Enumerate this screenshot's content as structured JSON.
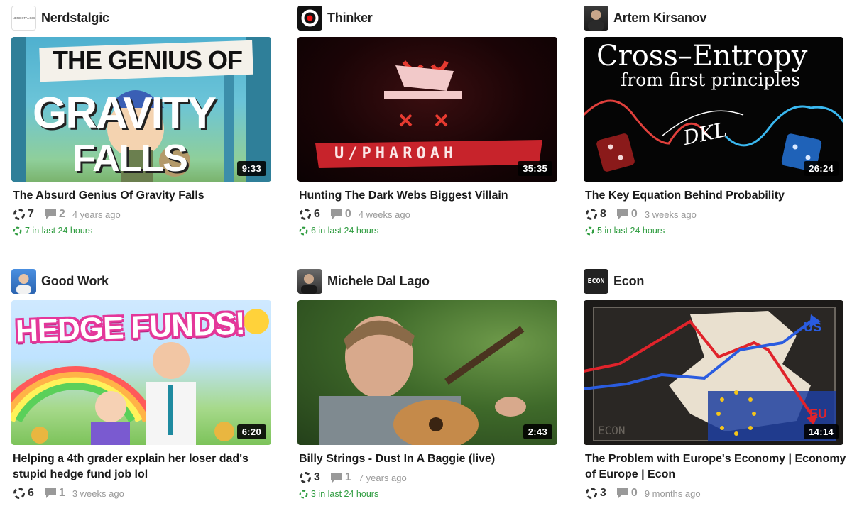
{
  "colors": {
    "recent_green": "#2e9c3f",
    "muted": "#999999",
    "title": "#1a1a1a"
  },
  "videos": [
    {
      "channel": "Nerdstalgic",
      "avatar_text": "NERDSTALGIC",
      "thumbnail_text": [
        "THE GENIUS OF",
        "GRAVITY",
        "FALLS"
      ],
      "duration": "9:33",
      "title": "The Absurd Genius Of Gravity Falls",
      "recommends": "7",
      "comments": "2",
      "ago": "4 years ago",
      "recent": "7 in last 24 hours"
    },
    {
      "channel": "Thinker",
      "avatar_text": "",
      "thumbnail_text": [
        "U/PHAROAH"
      ],
      "duration": "35:35",
      "title": "Hunting The Dark Webs Biggest Villain",
      "recommends": "6",
      "comments": "0",
      "ago": "4 weeks ago",
      "recent": "6 in last 24 hours"
    },
    {
      "channel": "Artem Kirsanov",
      "avatar_text": "",
      "thumbnail_text": [
        "Cross–Entropy",
        "from first principles",
        "DKL"
      ],
      "duration": "26:24",
      "title": "The Key Equation Behind Probability",
      "recommends": "8",
      "comments": "0",
      "ago": "3 weeks ago",
      "recent": "5 in last 24 hours"
    },
    {
      "channel": "Good Work",
      "avatar_text": "",
      "thumbnail_text": [
        "HEDGE FUNDS!"
      ],
      "duration": "6:20",
      "title": "Helping a 4th grader explain her loser dad's stupid hedge fund job lol",
      "recommends": "6",
      "comments": "1",
      "ago": "3 weeks ago",
      "recent": ""
    },
    {
      "channel": "Michele Dal Lago",
      "avatar_text": "",
      "thumbnail_text": [],
      "duration": "2:43",
      "title": "Billy Strings - Dust In A Baggie (live)",
      "recommends": "3",
      "comments": "1",
      "ago": "7 years ago",
      "recent": "3 in last 24 hours"
    },
    {
      "channel": "Econ",
      "avatar_text": "ECON",
      "thumbnail_text": [
        "US",
        "EU",
        "ECON"
      ],
      "duration": "14:14",
      "title": "The Problem with Europe's Economy | Economy of Europe | Econ",
      "recommends": "3",
      "comments": "0",
      "ago": "9 months ago",
      "recent": ""
    }
  ],
  "icons": {
    "recommend": "recommend-swirl-icon",
    "comment": "comment-bubble-icon",
    "recent": "recent-recommend-icon"
  }
}
